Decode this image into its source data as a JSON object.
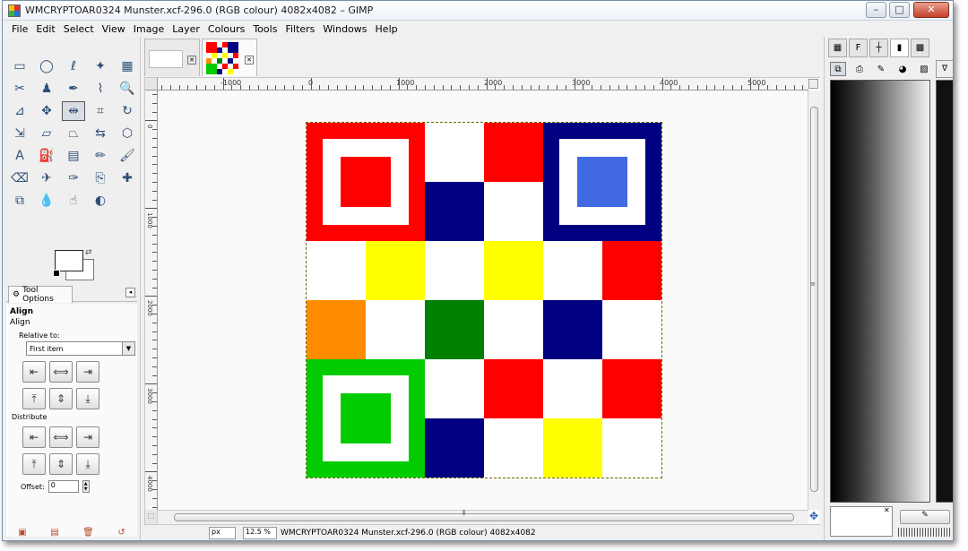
{
  "window": {
    "title": "WMCRYPTOAR0324 Munster.xcf-296.0 (RGB colour) 4082x4082 – GIMP",
    "controls": {
      "minimize": "–",
      "maximize": "□",
      "close": "✕"
    }
  },
  "menu": [
    "File",
    "Edit",
    "Select",
    "View",
    "Image",
    "Layer",
    "Colours",
    "Tools",
    "Filters",
    "Windows",
    "Help"
  ],
  "toolbox": {
    "tools": [
      {
        "name": "rect-select-icon",
        "glyph": "▭"
      },
      {
        "name": "ellipse-select-icon",
        "glyph": "◯"
      },
      {
        "name": "lasso-icon",
        "glyph": "ℓ"
      },
      {
        "name": "fuzzy-select-icon",
        "glyph": "✦"
      },
      {
        "name": "color-select-icon",
        "glyph": "▦"
      },
      {
        "name": "scissors-icon",
        "glyph": "✂"
      },
      {
        "name": "foreground-select-icon",
        "glyph": "♟"
      },
      {
        "name": "paths-icon",
        "glyph": "✒"
      },
      {
        "name": "color-picker-icon",
        "glyph": "⌇"
      },
      {
        "name": "zoom-icon",
        "glyph": "🔍"
      },
      {
        "name": "measure-icon",
        "glyph": "⊿"
      },
      {
        "name": "move-icon",
        "glyph": "✥"
      },
      {
        "name": "align-icon",
        "glyph": "⇹"
      },
      {
        "name": "crop-icon",
        "glyph": "⌗"
      },
      {
        "name": "rotate-icon",
        "glyph": "↻"
      },
      {
        "name": "scale-icon",
        "glyph": "⇲"
      },
      {
        "name": "shear-icon",
        "glyph": "▱"
      },
      {
        "name": "perspective-icon",
        "glyph": "⏢"
      },
      {
        "name": "flip-icon",
        "glyph": "⇆"
      },
      {
        "name": "cage-icon",
        "glyph": "⬡"
      },
      {
        "name": "text-icon",
        "glyph": "A"
      },
      {
        "name": "bucket-fill-icon",
        "glyph": "⛽"
      },
      {
        "name": "blend-icon",
        "glyph": "▤"
      },
      {
        "name": "pencil-icon",
        "glyph": "✏"
      },
      {
        "name": "paintbrush-icon",
        "glyph": "🖌"
      },
      {
        "name": "eraser-icon",
        "glyph": "⌫"
      },
      {
        "name": "airbrush-icon",
        "glyph": "✈"
      },
      {
        "name": "ink-icon",
        "glyph": "✑"
      },
      {
        "name": "clone-icon",
        "glyph": "⎘"
      },
      {
        "name": "heal-icon",
        "glyph": "✚"
      },
      {
        "name": "perspective-clone-icon",
        "glyph": "⧉"
      },
      {
        "name": "blur-icon",
        "glyph": "💧"
      },
      {
        "name": "smudge-icon",
        "glyph": "☝"
      },
      {
        "name": "dodge-burn-icon",
        "glyph": "◐"
      }
    ],
    "active_tool_index": 12,
    "tool_options_tab": "Tool Options",
    "options": {
      "title": "Align",
      "subtitle": "Align",
      "relative_label": "Relative to:",
      "relative_value": "First item",
      "distribute_label": "Distribute",
      "offset_label": "Offset:",
      "offset_value": "0"
    },
    "align_glyphs": [
      "⇤",
      "⟺",
      "⇥",
      "⤒",
      "⇕",
      "⤓"
    ],
    "distribute_glyphs": [
      "⇤",
      "⟺",
      "⇥",
      "⤒",
      "⇕",
      "⤓"
    ]
  },
  "image_tabs": {
    "close_glyph": "✕"
  },
  "canvas": {
    "ruler_labels": [
      "-1000",
      "0",
      "1000",
      "2000",
      "3000",
      "4000",
      "5000"
    ],
    "vruler_labels": [
      "0",
      "1000",
      "2000",
      "3000",
      "4000"
    ]
  },
  "board": {
    "colors": {
      "red": "#ff0000",
      "navy": "#000080",
      "yellow": "#ffff00",
      "orange": "#ff8c00",
      "green": "#008000",
      "lime": "#00cc00",
      "white": "#ffffff",
      "royal": "#4169e1"
    },
    "grid": [
      [
        "F1",
        "F1",
        "white",
        "red",
        "F2",
        "F2"
      ],
      [
        "F1",
        "F1",
        "navy",
        "white",
        "F2",
        "F2"
      ],
      [
        "white",
        "yellow",
        "white",
        "yellow",
        "white",
        "red"
      ],
      [
        "orange",
        "white",
        "green",
        "white",
        "navy",
        "white"
      ],
      [
        "F3",
        "F3",
        "white",
        "red",
        "white",
        "red"
      ],
      [
        "F3",
        "F3",
        "navy",
        "white",
        "yellow",
        "white"
      ]
    ],
    "frames": [
      {
        "id": "F1",
        "outer": "red",
        "center": "red"
      },
      {
        "id": "F2",
        "outer": "navy",
        "center": "royal"
      },
      {
        "id": "F3",
        "outer": "lime",
        "center": "lime"
      }
    ]
  },
  "status": {
    "unit": "px",
    "zoom": "12.5 %",
    "text": "WMCRYPTOAR0324 Munster.xcf-296.0 (RGB colour) 4082x4082"
  },
  "dock": {
    "close_glyph": "✕"
  }
}
